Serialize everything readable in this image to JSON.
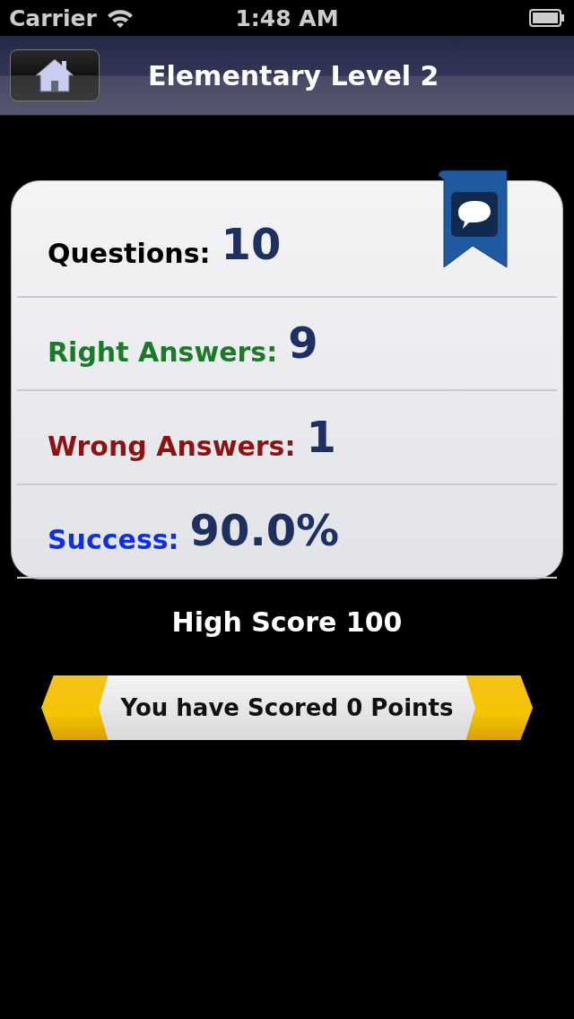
{
  "status_bar": {
    "carrier": "Carrier",
    "time": "1:48 AM"
  },
  "nav_bar": {
    "title": "Elementary Level 2"
  },
  "stats": [
    {
      "label": "Questions:",
      "value": "10",
      "color": "#000000"
    },
    {
      "label": "Right Answers:",
      "value": "9",
      "color": "#1a7a2a"
    },
    {
      "label": "Wrong Answers:",
      "value": "1",
      "color": "#8a1414"
    },
    {
      "label": "Success:",
      "value": "90.0%",
      "color": "#1030e0"
    }
  ],
  "high_score": "High Score 100",
  "score_banner": "You have Scored 0 Points"
}
